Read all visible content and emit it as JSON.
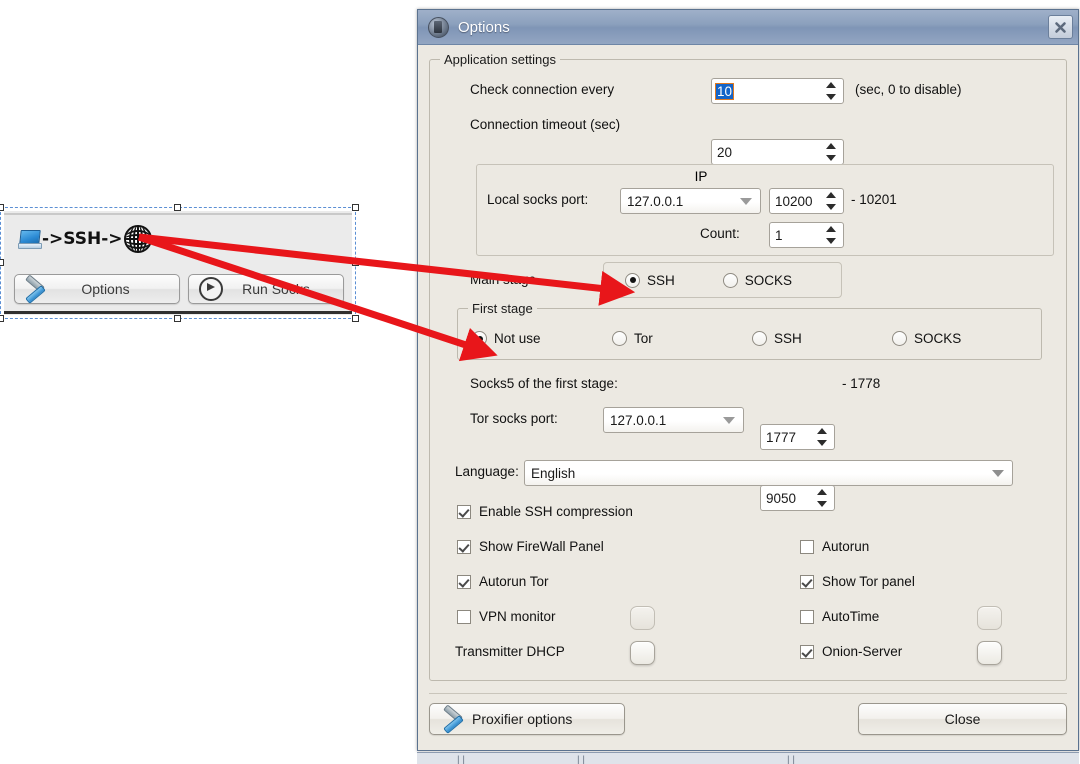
{
  "widget": {
    "title_prefix_icon": "computer-icon",
    "title_text": "->SSH->",
    "title_suffix_icon": "globe-icon",
    "options_button": "Options",
    "run_socks_button": "Run Socks"
  },
  "dialog": {
    "title": "Options",
    "close_tooltip": "Close",
    "app_settings": {
      "legend": "Application settings",
      "check_connection_label": "Check connection every",
      "check_connection_value": "10",
      "check_connection_hint": "(sec, 0 to disable)",
      "connection_timeout_label": "Connection timeout (sec)",
      "connection_timeout_value": "20",
      "ip": {
        "caption": "IP",
        "local_socks_port_label": "Local socks port:",
        "local_socks_host": "127.0.0.1",
        "local_socks_port": "10200",
        "local_socks_port_range": "- 10201",
        "count_label": "Count:",
        "count_value": "1"
      },
      "main_stage": {
        "label": "Main stage",
        "options": [
          {
            "label": "SSH",
            "selected": true
          },
          {
            "label": "SOCKS",
            "selected": false
          }
        ]
      },
      "first_stage": {
        "legend": "First stage",
        "options": [
          {
            "label": "Not use",
            "selected": true
          },
          {
            "label": "Tor",
            "selected": false
          },
          {
            "label": "SSH",
            "selected": false
          },
          {
            "label": "SOCKS",
            "selected": false
          }
        ]
      },
      "socks5_first_stage_label": "Socks5 of the first stage:",
      "socks5_first_stage_value": "1777",
      "socks5_first_stage_range": "- 1778",
      "tor_socks_port_label": "Tor socks port:",
      "tor_socks_host": "127.0.0.1",
      "tor_socks_port": "9050",
      "language_label": "Language:",
      "language_value": "English",
      "checks": {
        "enable_ssh_compression": {
          "label": "Enable SSH compression",
          "checked": true
        },
        "show_firewall_panel": {
          "label": "Show FireWall Panel",
          "checked": true
        },
        "autorun": {
          "label": "Autorun",
          "checked": false
        },
        "autorun_tor": {
          "label": "Autorun Tor",
          "checked": true
        },
        "show_tor_panel": {
          "label": "Show Tor panel",
          "checked": true
        },
        "vpn_monitor": {
          "label": "VPN monitor",
          "checked": false
        },
        "autotime": {
          "label": "AutoTime",
          "checked": false
        },
        "transmitter_dhcp": {
          "label": "Transmitter DHCP"
        },
        "onion_server": {
          "label": "Onion-Server",
          "checked": true
        }
      }
    },
    "footer": {
      "proxifier_button": "Proxifier options",
      "close_button": "Close"
    }
  },
  "colors": {
    "accent_red": "#e8161a",
    "titlebar": "#8ba0bd",
    "dialog_bg": "#ece9e2",
    "selection_blue": "#1464c8",
    "selection_dashed": "#5b8fd4"
  }
}
